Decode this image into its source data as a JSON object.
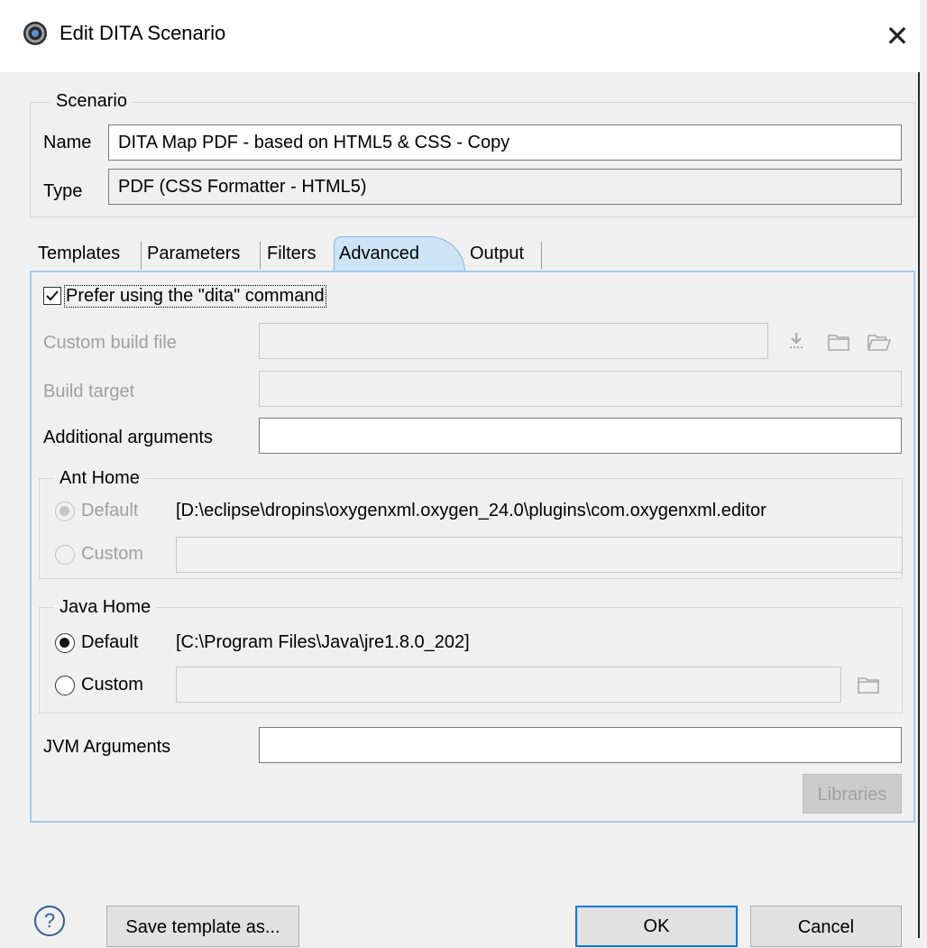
{
  "window": {
    "title": "Edit DITA Scenario"
  },
  "scenario": {
    "group_title": "Scenario",
    "name_label": "Name",
    "name_value": "DITA Map PDF - based on HTML5 & CSS - Copy",
    "type_label": "Type",
    "type_value": "PDF (CSS Formatter - HTML5)"
  },
  "tabs": [
    {
      "label": "Templates",
      "active": false
    },
    {
      "label": "Parameters",
      "active": false
    },
    {
      "label": "Filters",
      "active": false
    },
    {
      "label": "Advanced",
      "active": true
    },
    {
      "label": "Output",
      "active": false
    }
  ],
  "advanced": {
    "prefer_dita_label": "Prefer using the \"dita\" command",
    "prefer_dita_checked": true,
    "custom_build_file_label": "Custom build file",
    "custom_build_file_value": "",
    "build_target_label": "Build target",
    "build_target_value": "",
    "additional_arguments_label": "Additional arguments",
    "additional_arguments_value": "",
    "ant_home": {
      "title": "Ant Home",
      "default_label": "Default",
      "default_path": "[D:\\eclipse\\dropins\\oxygenxml.oxygen_24.0\\plugins\\com.oxygenxml.editor",
      "custom_label": "Custom",
      "selected": "default"
    },
    "java_home": {
      "title": "Java Home",
      "default_label": "Default",
      "default_path": "[C:\\Program Files\\Java\\jre1.8.0_202]",
      "custom_label": "Custom",
      "selected": "default"
    },
    "jvm_arguments_label": "JVM Arguments",
    "jvm_arguments_value": "",
    "libraries_label": "Libraries"
  },
  "footer": {
    "help_label": "?",
    "save_template_label": "Save template as...",
    "ok_label": "OK",
    "cancel_label": "Cancel"
  },
  "icons": [
    "app-icon",
    "close-icon",
    "download-icon",
    "folder-icon",
    "folder-open-icon",
    "help-icon"
  ],
  "colors": {
    "active_tab": "#cde4f7",
    "panel_border": "#a6c8e8",
    "default_button_border": "#0078d7"
  }
}
